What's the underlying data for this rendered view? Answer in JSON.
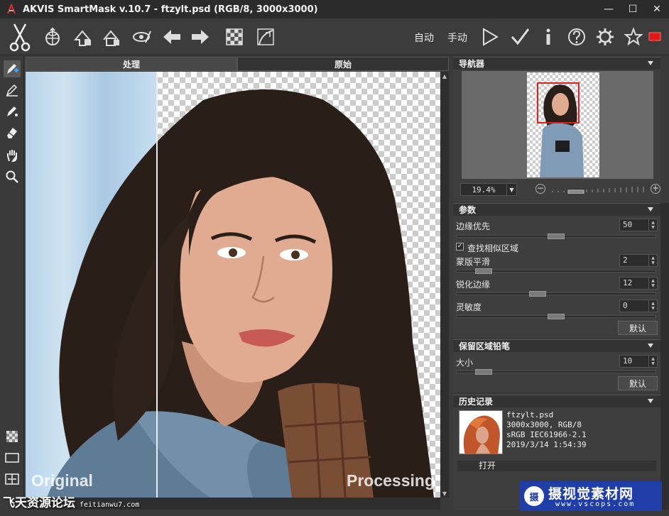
{
  "window": {
    "title": "AKVIS SmartMask v.10.7 - ftzylt.psd (RGB/8, 3000x3000)",
    "minimize": "—",
    "maximize": "☐",
    "close": "✕"
  },
  "toolbar": {
    "auto_label": "自动",
    "manual_label": "手动"
  },
  "tabs": {
    "processed": "处理",
    "original": "原始"
  },
  "canvas": {
    "label_left": "Original",
    "label_right": "Processing"
  },
  "watermark_left": {
    "text": "飞天资源论坛",
    "url": "feitianwu7.com"
  },
  "navigator": {
    "title": "导航器",
    "zoom": "19.4%"
  },
  "params": {
    "title": "参数",
    "edge_priority": {
      "label": "边缘优先",
      "value": "50",
      "level": 0.5
    },
    "find_similar": {
      "label": "查找相似区域",
      "checked": "✓"
    },
    "mask_smooth": {
      "label": "蒙版平滑",
      "value": "2",
      "level": 0.1
    },
    "sharpen_edge": {
      "label": "锐化边缘",
      "value": "12",
      "level": 0.4
    },
    "sensitivity": {
      "label": "灵敏度",
      "value": "0",
      "level": 0.5
    },
    "default_btn": "默认"
  },
  "keep_pencil": {
    "title": "保留区域铅笔",
    "size": {
      "label": "大小",
      "value": "10",
      "level": 0.1
    },
    "default_btn": "默认"
  },
  "history": {
    "title": "历史记录",
    "filename": "ftzylt.psd",
    "dims": "3000x3000, RGB/8",
    "profile": "sRGB IEC61966-2.1",
    "date": "2019/3/14 1:54:39",
    "item": "打开"
  },
  "watermark_right": {
    "logo": "摄",
    "big": "摄视觉素材网",
    "small": "www.vscops.com"
  }
}
